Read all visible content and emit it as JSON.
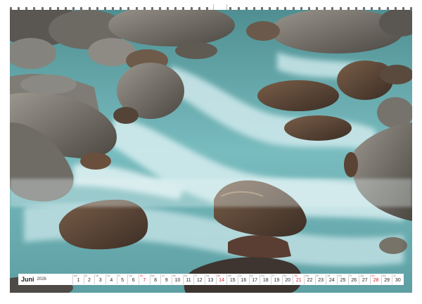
{
  "calendar": {
    "month": "Juni",
    "year": "2026",
    "days": [
      {
        "n": "1",
        "wd": "Mo",
        "sunday": false
      },
      {
        "n": "2",
        "wd": "Di",
        "sunday": false
      },
      {
        "n": "3",
        "wd": "Mi",
        "sunday": false
      },
      {
        "n": "4",
        "wd": "Do",
        "sunday": false
      },
      {
        "n": "5",
        "wd": "Fr",
        "sunday": false
      },
      {
        "n": "6",
        "wd": "Sa",
        "sunday": false
      },
      {
        "n": "7",
        "wd": "So",
        "sunday": true
      },
      {
        "n": "8",
        "wd": "Mo",
        "sunday": false
      },
      {
        "n": "9",
        "wd": "Di",
        "sunday": false
      },
      {
        "n": "10",
        "wd": "Mi",
        "sunday": false
      },
      {
        "n": "11",
        "wd": "Do",
        "sunday": false
      },
      {
        "n": "12",
        "wd": "Fr",
        "sunday": false
      },
      {
        "n": "13",
        "wd": "Sa",
        "sunday": false
      },
      {
        "n": "14",
        "wd": "So",
        "sunday": true
      },
      {
        "n": "15",
        "wd": "Mo",
        "sunday": false
      },
      {
        "n": "16",
        "wd": "Di",
        "sunday": false
      },
      {
        "n": "17",
        "wd": "Mi",
        "sunday": false
      },
      {
        "n": "18",
        "wd": "Do",
        "sunday": false
      },
      {
        "n": "19",
        "wd": "Fr",
        "sunday": false
      },
      {
        "n": "20",
        "wd": "Sa",
        "sunday": false
      },
      {
        "n": "21",
        "wd": "So",
        "sunday": true
      },
      {
        "n": "22",
        "wd": "Mo",
        "sunday": false
      },
      {
        "n": "23",
        "wd": "Di",
        "sunday": false
      },
      {
        "n": "24",
        "wd": "Mi",
        "sunday": false
      },
      {
        "n": "25",
        "wd": "Do",
        "sunday": false
      },
      {
        "n": "26",
        "wd": "Fr",
        "sunday": false
      },
      {
        "n": "27",
        "wd": "Sa",
        "sunday": false
      },
      {
        "n": "28",
        "wd": "So",
        "sunday": true
      },
      {
        "n": "29",
        "wd": "Mo",
        "sunday": false
      },
      {
        "n": "30",
        "wd": "Di",
        "sunday": false
      }
    ]
  },
  "colors": {
    "water": "#6fb3b5",
    "foam": "#d9eef0",
    "rock_dark": "#4a4640",
    "rock_light": "#8a8882",
    "sunday": "#d21f2c"
  },
  "binding": {
    "ring_count": 52
  }
}
